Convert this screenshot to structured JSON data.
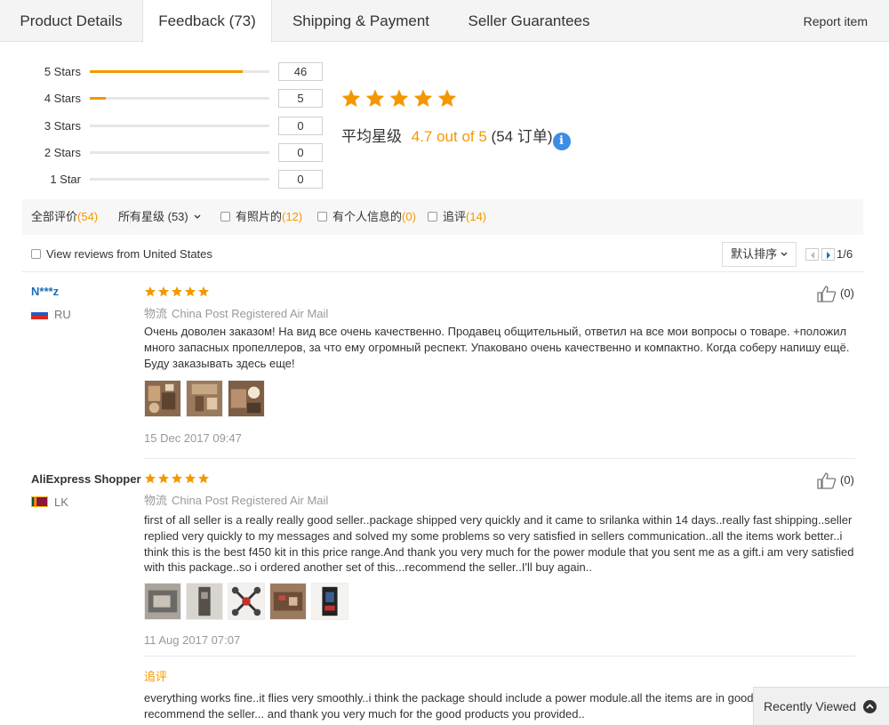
{
  "tabs": [
    {
      "label": "Product Details"
    },
    {
      "label": "Feedback (73)"
    },
    {
      "label": "Shipping & Payment"
    },
    {
      "label": "Seller Guarantees"
    }
  ],
  "report_label": "Report item",
  "histogram": [
    {
      "label": "5 Stars",
      "count": "46",
      "fraction": 0.85
    },
    {
      "label": "4 Stars",
      "count": "5",
      "fraction": 0.09
    },
    {
      "label": "3 Stars",
      "count": "0",
      "fraction": 0
    },
    {
      "label": "2 Stars",
      "count": "0",
      "fraction": 0
    },
    {
      "label": "1 Star",
      "count": "0",
      "fraction": 0
    }
  ],
  "rating": {
    "stars": 5,
    "prefix": "平均星级",
    "score": "4.7 out of 5",
    "orders": "(54 订单)",
    "info_glyph": "i"
  },
  "filters": {
    "all_label": "全部评价",
    "all_count": "(54)",
    "stars_label": "所有星级 (53)",
    "photos_label": "有照片的",
    "photos_count": "(12)",
    "personal_label": "有个人信息的",
    "personal_count": "(0)",
    "additional_label": "追评",
    "additional_count": "(14)"
  },
  "view_us_label": "View reviews from United States",
  "sort_label": "默认排序",
  "pagination": "1/6",
  "reviews": [
    {
      "user": "N***z",
      "country": "RU",
      "stars": 5,
      "shipping_prefix": "物流",
      "shipping": "China Post Registered Air Mail",
      "text": "Очень доволен заказом! На вид все очень качественно. Продавец общительный, ответил на все мои вопросы о товаре. +положил много запасных пропеллеров, за что ему огромный респект. Упаковано очень качественно и компактно. Когда соберу напишу ещё. Буду заказывать здесь еще!",
      "date": "15 Dec 2017 09:47",
      "likes": "(0)"
    },
    {
      "user": "AliExpress Shopper",
      "country": "LK",
      "stars": 5,
      "shipping_prefix": "物流",
      "shipping": "China Post Registered Air Mail",
      "text": "first of all seller is a really really good seller..package shipped very quickly and it came to srilanka within 14 days..really fast shipping..seller replied very quickly to my messages and solved my some problems so very satisfied in sellers communication..all the items work better..i think this is the best f450 kit in this price range.And thank you very much for the power module that you sent me as a gift.i am very satisfied with this package..so i ordered another set of this...recommend the seller..I'll buy again..",
      "date": "11 Aug 2017 07:07",
      "likes": "(0)",
      "additional_label": "追评",
      "additional_text": "everything works fine..it flies very smoothly..i think the package should include a power module.all the items are in good condition..i recommend the seller... and thank you very much for the good products you provided.."
    }
  ],
  "recently_viewed": "Recently Viewed",
  "colors": {
    "accent": "#f39800",
    "username_blue": "#1a6fb9",
    "info_blue": "#3a8ee6"
  }
}
